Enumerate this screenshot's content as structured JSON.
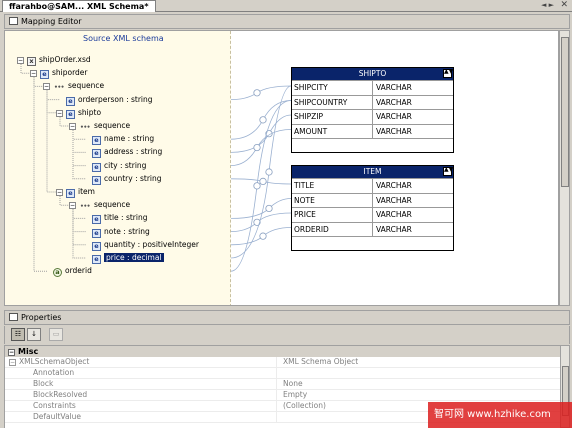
{
  "tab": {
    "title": "ffarahbo@SAM... XML Schema*"
  },
  "mapping_editor": {
    "title": "Mapping Editor",
    "source_title": "Source XML schema",
    "tree": [
      {
        "label": "shipOrder.xsd",
        "kind": "file",
        "depth": 0
      },
      {
        "label": "shiporder",
        "kind": "element",
        "depth": 1
      },
      {
        "label": "sequence",
        "kind": "sequence",
        "depth": 2
      },
      {
        "label": "orderperson : string",
        "kind": "element",
        "depth": 3
      },
      {
        "label": "shipto",
        "kind": "element",
        "depth": 3
      },
      {
        "label": "sequence",
        "kind": "sequence",
        "depth": 4
      },
      {
        "label": "name : string",
        "kind": "element",
        "depth": 5
      },
      {
        "label": "address : string",
        "kind": "element",
        "depth": 5
      },
      {
        "label": "city : string",
        "kind": "element",
        "depth": 5
      },
      {
        "label": "country : string",
        "kind": "element",
        "depth": 5
      },
      {
        "label": "item",
        "kind": "element",
        "depth": 3
      },
      {
        "label": "sequence",
        "kind": "sequence",
        "depth": 4
      },
      {
        "label": "title : string",
        "kind": "element",
        "depth": 5
      },
      {
        "label": "note : string",
        "kind": "element",
        "depth": 5
      },
      {
        "label": "quantity : positiveInteger",
        "kind": "element",
        "depth": 5
      },
      {
        "label": "price : decimal",
        "kind": "element",
        "depth": 5,
        "selected": true
      },
      {
        "label": "orderid",
        "kind": "attribute",
        "depth": 2
      }
    ],
    "tables": [
      {
        "name": "SHIPTO",
        "rows": [
          [
            "SHIPCITY",
            "VARCHAR"
          ],
          [
            "SHIPCOUNTRY",
            "VARCHAR"
          ],
          [
            "SHIPZIP",
            "VARCHAR"
          ],
          [
            "AMOUNT",
            "VARCHAR"
          ]
        ]
      },
      {
        "name": "ITEM",
        "rows": [
          [
            "TITLE",
            "VARCHAR"
          ],
          [
            "NOTE",
            "VARCHAR"
          ],
          [
            "PRICE",
            "VARCHAR"
          ],
          [
            "ORDERID",
            "VARCHAR"
          ]
        ]
      }
    ]
  },
  "properties": {
    "title": "Properties",
    "category": "Misc",
    "rows": [
      {
        "name": "XMLSchemaObject",
        "value": "XML Schema Object",
        "expandable": true
      },
      {
        "name": "Annotation",
        "value": ""
      },
      {
        "name": "Block",
        "value": "None"
      },
      {
        "name": "BlockResolved",
        "value": "Empty"
      },
      {
        "name": "Constraints",
        "value": "(Collection)"
      },
      {
        "name": "DefaultValue",
        "value": ""
      }
    ]
  },
  "watermark": {
    "text": "智可网  www.hzhike.com"
  }
}
